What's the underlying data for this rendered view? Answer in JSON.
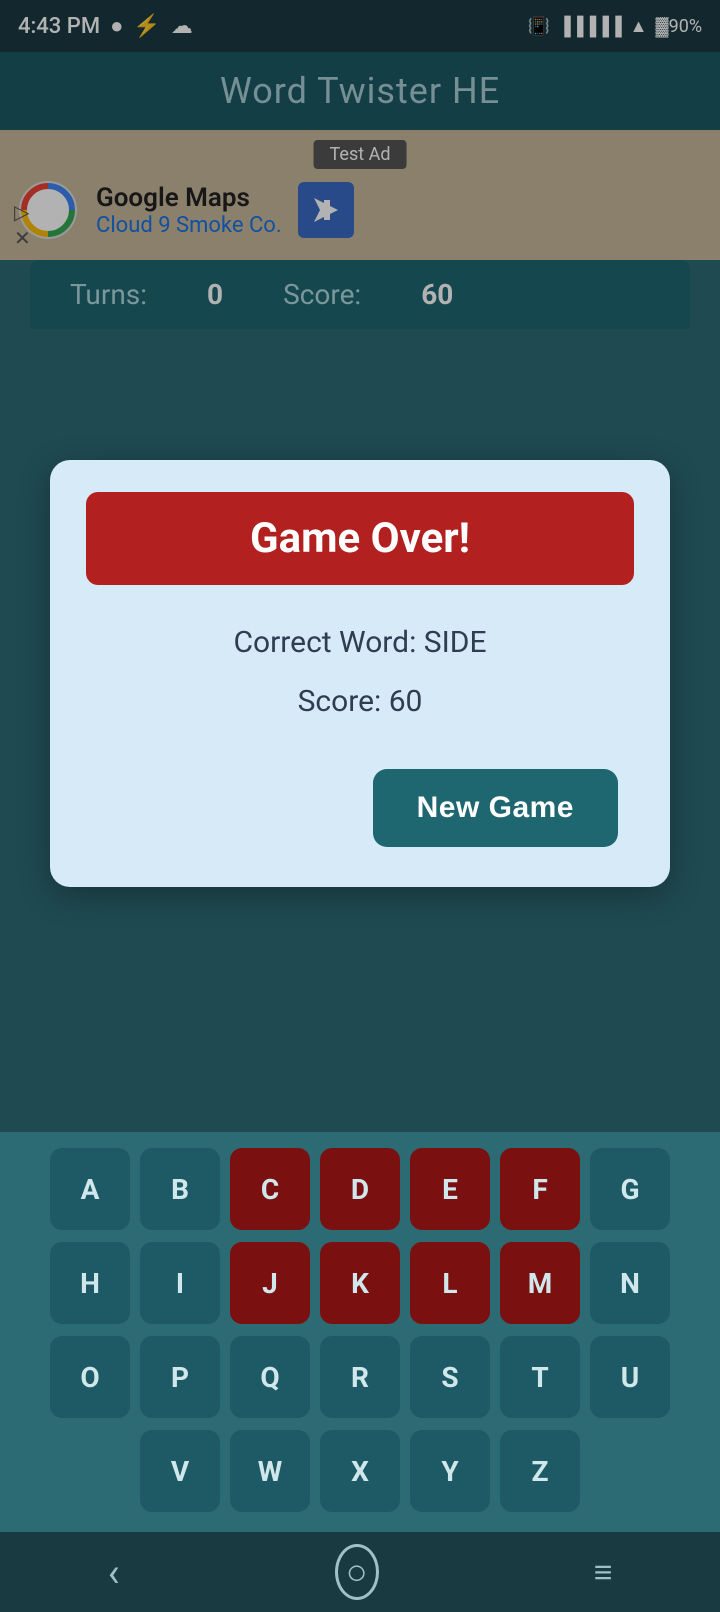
{
  "statusBar": {
    "time": "4:43 PM",
    "battery": "90"
  },
  "appTitle": "Word Twister HE",
  "ad": {
    "label": "Test Ad",
    "businessName": "Google Maps",
    "businessSub": "Cloud 9 Smoke Co."
  },
  "scoreBar": {
    "turnsLabel": "Turns:",
    "turnsValue": "0",
    "scoreLabel": "Score:",
    "scoreValue": "60"
  },
  "dialog": {
    "title": "Game Over!",
    "correctWordLabel": "Correct Word: SIDE",
    "scoreLabel": "Score: 60",
    "newGameButton": "New Game"
  },
  "keyboard": {
    "rows": [
      [
        "A",
        "B",
        "C",
        "D",
        "E",
        "F",
        "G"
      ],
      [
        "H",
        "I",
        "J",
        "K",
        "L",
        "M",
        "N"
      ],
      [
        "O",
        "P",
        "Q",
        "R",
        "S",
        "T",
        "U"
      ],
      [
        "V",
        "W",
        "X",
        "Y",
        "Z"
      ]
    ],
    "usedDark": [
      "C",
      "D",
      "E",
      "F",
      "J",
      "K",
      "L",
      "M"
    ],
    "usedMedium": []
  },
  "navBar": {
    "back": "‹",
    "home": "○",
    "menu": "≡"
  }
}
